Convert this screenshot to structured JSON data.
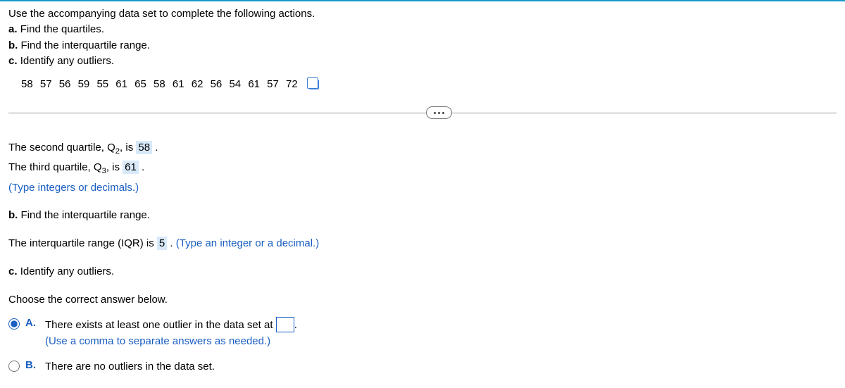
{
  "prompt": {
    "intro": "Use the accompanying data set to complete the following actions.",
    "a": "Find the quartiles.",
    "b": "Find the interquartile range.",
    "c": "Identify any outliers."
  },
  "data_values": [
    "58",
    "57",
    "56",
    "59",
    "55",
    "61",
    "65",
    "58",
    "61",
    "62",
    "56",
    "54",
    "61",
    "57",
    "72"
  ],
  "q2_line_pre": "The second quartile, Q",
  "q2_sub": "2",
  "q2_line_mid": ", is ",
  "q2_value": "58",
  "q3_line_pre": "The third quartile, Q",
  "q3_sub": "3",
  "q3_line_mid": ", is ",
  "q3_value": "61",
  "period": " .",
  "type_hint": "(Type integers or decimals.)",
  "partb_heading": "Find the interquartile range.",
  "iqr_pre": "The interquartile range (IQR) is ",
  "iqr_value": "5",
  "iqr_post": " . ",
  "iqr_hint": "(Type an integer or a decimal.)",
  "partc_heading": "Identify any outliers.",
  "choose_text": "Choose the correct answer below.",
  "options": {
    "a_label": "A.",
    "a_text_pre": "There exists at least one outlier in the data set at ",
    "a_text_post": ".",
    "a_hint": "(Use a comma to separate answers as needed.)",
    "b_label": "B.",
    "b_text": "There are no outliers in the data set."
  }
}
